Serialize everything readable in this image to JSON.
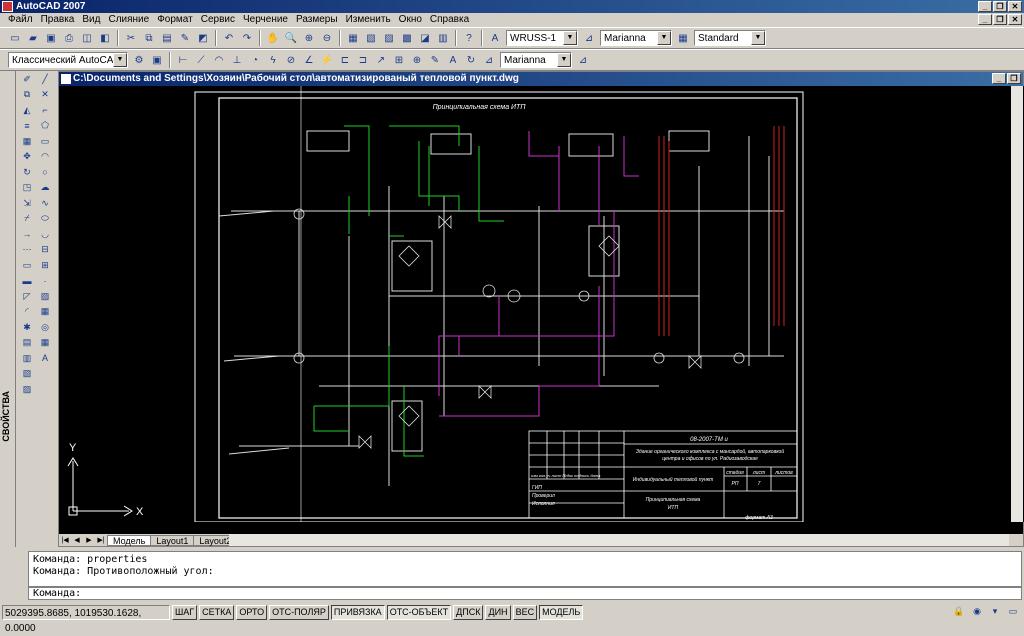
{
  "window": {
    "title": "AutoCAD 2007",
    "min_label": "_",
    "max_label": "❐",
    "close_label": "✕"
  },
  "menu": [
    "Файл",
    "Правка",
    "Вид",
    "Слияние",
    "Формат",
    "Сервис",
    "Черчение",
    "Размеры",
    "Изменить",
    "Окно",
    "Справка"
  ],
  "toolbar1": {
    "text_style": "WRUSS-1",
    "dim_style": "Marianna",
    "table_style": "Standard"
  },
  "toolbar2": {
    "workspace": "Классический AutoCAD",
    "mleader_style": "Marianna"
  },
  "left_panel": {
    "label": "СВОЙСТВА"
  },
  "drawing": {
    "path": "C:\\Documents and Settings\\Хозяин\\Рабочий стол\\автоматизированый тепловой пункт.dwg",
    "sheet_title": "Принципиальная схема ИТП",
    "stamp": {
      "code": "08-2007-ТМ и",
      "description": "Здание органического комплекса с мансардой, автопарковкой",
      "description2": "центра и офисов по ул. Радиозаводская",
      "col_headers": [
        "стадия",
        "лист",
        "листов"
      ],
      "stage": "РП",
      "sheet": "7",
      "project": "Индивидуальный тепловой пункт",
      "drawing_name": "Принципиальная схема",
      "drawing_name2": "ИТП",
      "roles": [
        "ГИП",
        "Проверил",
        "Исполнил"
      ],
      "row_header": "изм кол.уч лист №док подпись дата",
      "format": "формат А3"
    },
    "ucs_x": "X",
    "ucs_y": "Y"
  },
  "layout_tabs": [
    "Модель",
    "Layout1",
    "Layout2"
  ],
  "command": {
    "history": [
      "Команда: properties",
      "Команда: Противоположный угол:"
    ],
    "prompt": "Команда:"
  },
  "status": {
    "coords": "5029395.8685, 1019530.1628, 0.0000",
    "buttons": [
      {
        "label": "ШАГ",
        "on": false
      },
      {
        "label": "СЕТКА",
        "on": false
      },
      {
        "label": "ОРТО",
        "on": false
      },
      {
        "label": "ОТС-ПОЛЯР",
        "on": false
      },
      {
        "label": "ПРИВЯЗКА",
        "on": true
      },
      {
        "label": "ОТС-ОБЪЕКТ",
        "on": true
      },
      {
        "label": "ДПСК",
        "on": false
      },
      {
        "label": "ДИН",
        "on": false
      },
      {
        "label": "ВЕС",
        "on": false
      },
      {
        "label": "МОДЕЛЬ",
        "on": true
      }
    ]
  },
  "colors": {
    "canvas_bg": "#000000",
    "frame": "#ffffff",
    "pipe_green": "#22cc22",
    "pipe_magenta": "#cc33cc",
    "pipe_red": "#cc2222",
    "title_blue": "#0a246a"
  }
}
